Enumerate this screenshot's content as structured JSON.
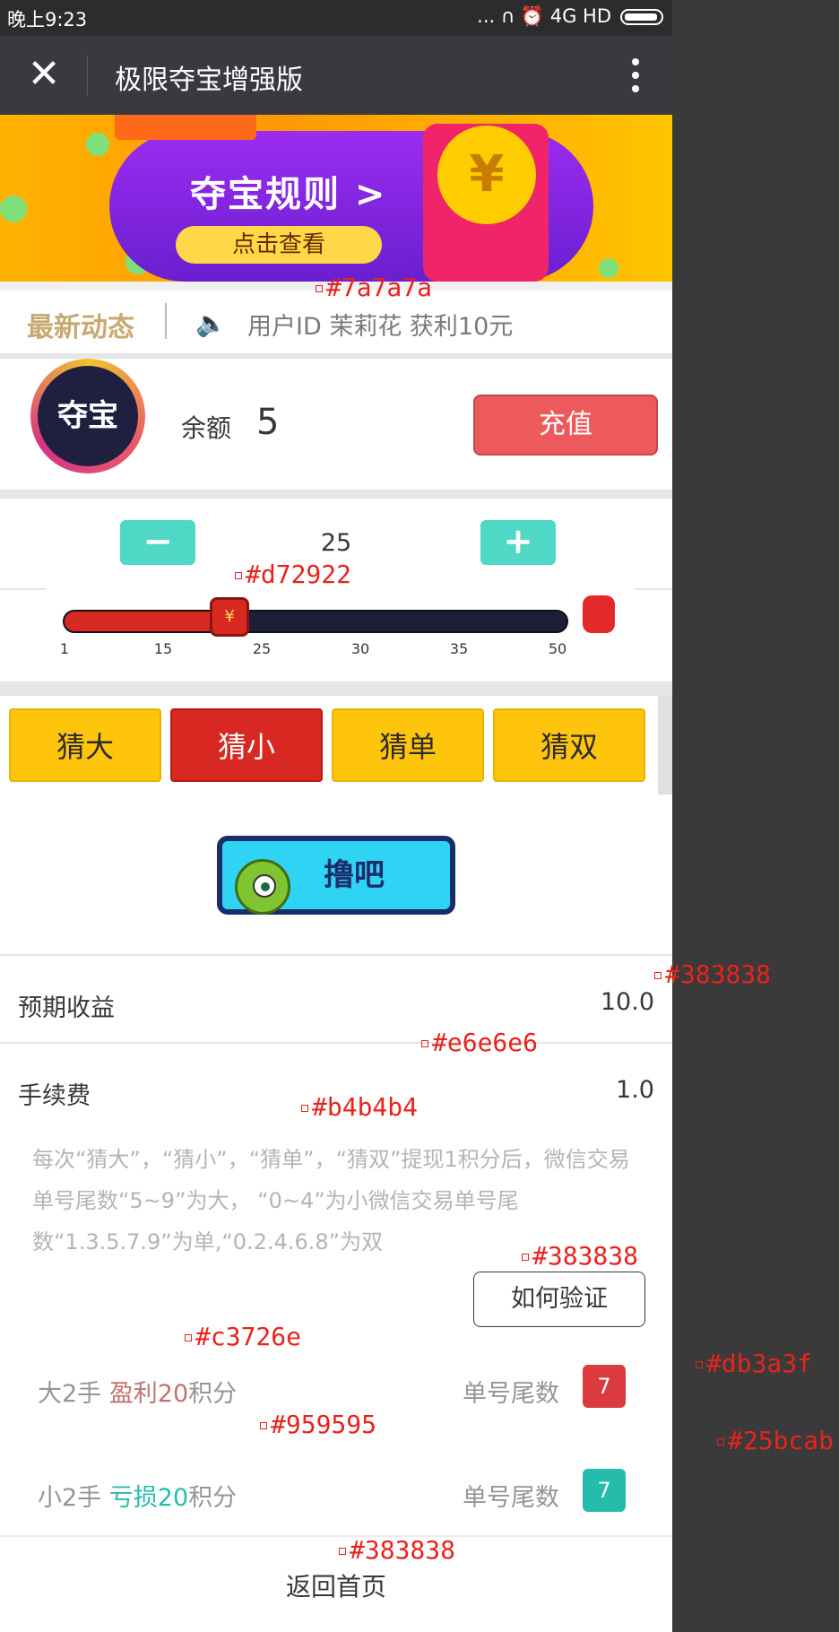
{
  "status_bar": {
    "time": "晚上9:23",
    "indicators": "... ∩ ⏰  4G HD"
  },
  "nav": {
    "close_icon": "✕",
    "title": "极限夺宝增强版"
  },
  "banner": {
    "title": "夺宝规则 >",
    "button": "点击查看",
    "coin_symbol": "¥"
  },
  "ticker": {
    "label": "最新动态",
    "message": "用户ID 茉莉花 获利10元"
  },
  "account": {
    "avatar_text": "夺宝",
    "balance_label": "余额",
    "balance_value": "5",
    "recharge_label": "充值"
  },
  "stepper": {
    "minus_label": "−",
    "plus_label": "+",
    "value": "25",
    "progress_fraction": 0.33,
    "ticks": [
      "1",
      "15",
      "25",
      "30",
      "35",
      "50"
    ]
  },
  "guess_options": [
    {
      "label": "猜大",
      "selected": false
    },
    {
      "label": "猜小",
      "selected": true
    },
    {
      "label": "猜单",
      "selected": false
    },
    {
      "label": "猜双",
      "selected": false
    }
  ],
  "go_button": {
    "label": "撸吧"
  },
  "summary": {
    "expected_label": "预期收益",
    "expected_value": "10.0",
    "fee_label": "手续费",
    "fee_value": "1.0"
  },
  "rules_text": "每次“猜大”，“猜小”，“猜单”，“猜双”提现1积分后，微信交易单号尾数“5~9”为大， “0~4”为小微信交易单号尾数“1.3.5.7.9”为单,“0.2.4.6.8”为双",
  "verify_button": "如何验证",
  "results": [
    {
      "prefix": "大2手 ",
      "highlight": "盈利20",
      "suffix": "积分",
      "right_label": "单号尾数",
      "digit": "7",
      "badge_color": "#db3a3f"
    },
    {
      "prefix": "小2手 ",
      "highlight": "亏损20",
      "suffix": "积分",
      "right_label": "单号尾数",
      "digit": "7",
      "badge_color": "#25bcab"
    }
  ],
  "footer": {
    "back_home": "返回首页"
  },
  "annotations": {
    "ticker_color": "#7a7a7a",
    "slider_color": "#d72922",
    "value_color_1": "#383838",
    "divider_color": "#e6e6e6",
    "rules_color": "#b4b4b4",
    "verify_color": "#383838",
    "profit_color": "#c3726e",
    "label_color": "#959595",
    "badge_red": "#db3a3f",
    "badge_teal": "#25bcab",
    "footer_color": "#383838"
  },
  "colors": {
    "accent_red": "#d72922",
    "teal": "#4fd8c6",
    "yellow": "#ffc50d",
    "nav_bg": "#393a3f"
  }
}
